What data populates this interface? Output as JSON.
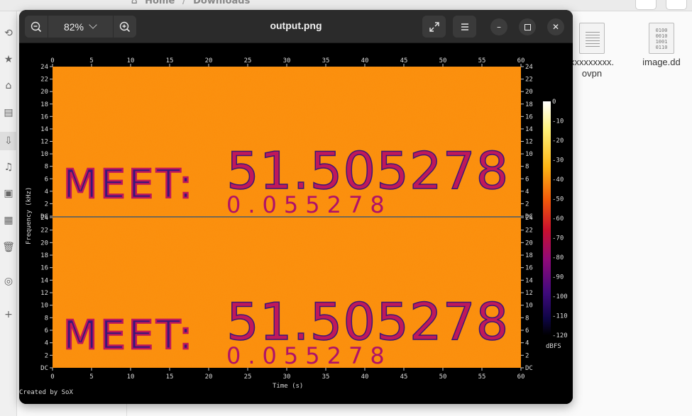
{
  "file_manager": {
    "breadcrumb": [
      "Home",
      "Downloads"
    ],
    "files": [
      {
        "name": "xxxxxxxxx.\novpn",
        "line1": "xxxxxxxxx.",
        "line2": "ovpn",
        "icon": "text-file-icon"
      },
      {
        "name": "image.dd",
        "line1": "image.dd",
        "line2": "",
        "icon": "binary-file-icon"
      }
    ],
    "bin_digits": "0100\n0010\n1001\n0110"
  },
  "viewer": {
    "zoom": "82%",
    "title": "output.png"
  },
  "spectrogram": {
    "x_label": "Time (s)",
    "y_label": "Frequency (kHz)",
    "colorbar_label": "dBFS",
    "credit": "Created by SoX",
    "x_ticks": [
      "0",
      "5",
      "10",
      "15",
      "20",
      "25",
      "30",
      "35",
      "40",
      "45",
      "50",
      "55",
      "60"
    ],
    "y_ticks": [
      "DC",
      "2",
      "4",
      "6",
      "8",
      "10",
      "12",
      "14",
      "16",
      "18",
      "20",
      "22",
      "24"
    ],
    "colorbar_ticks": [
      "0",
      "-10",
      "-20",
      "-30",
      "-40",
      "-50",
      "-60",
      "-70",
      "-80",
      "-90",
      "-100",
      "-110",
      "-120"
    ],
    "hidden_text_line1": "MEET:",
    "hidden_text_num1": "51.505278",
    "hidden_text_num2": "0.055278",
    "colors": {
      "background": "#fb8c08",
      "ink": "#3a1678"
    }
  }
}
